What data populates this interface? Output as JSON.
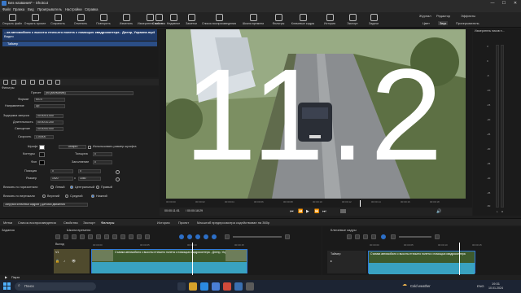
{
  "window": {
    "title": "Без названия* - Shotcut",
    "min": "—",
    "max": "☐",
    "close": "✕"
  },
  "menu": [
    "Файл",
    "Правка",
    "Вид",
    "Проигрыватель",
    "Настройки",
    "Справка"
  ],
  "toolbar": {
    "buttons": [
      "Открыть файл",
      "Открыть прочее",
      "Сохранить",
      "Отменить",
      "Повторить",
      "Изменить",
      "Выделить",
      "Измеритель пиков",
      "Свойства",
      "Недавние",
      "Заметки",
      "Список воспроизведения",
      "Шкала времени",
      "Фильтры",
      "Ключевые кадры",
      "История",
      "Экспорт",
      "Задачи"
    ],
    "layouts_top": [
      "Журнал",
      "Редактор",
      "Эффекты"
    ],
    "layouts_bottom": [
      "Цвет",
      "Звук",
      "Проигрыватель"
    ],
    "active_layout": "Звук"
  },
  "playlist": {
    "header": "...ка автомобиля с высоты птичьего полета с помощью квадрокоптера - Днепр, Украина.mp4",
    "subheader": "Видео",
    "item": "Таймер"
  },
  "filters": {
    "title": "Фильтры",
    "preset_label": "Пресет",
    "preset_value": "(по умолчанию)",
    "format_label": "Формат",
    "format_value": "SS.S",
    "direction_label": "Направление",
    "direction_value": "Up",
    "delay_label": "Задержка запуска",
    "delay_value": "00:00:01.000",
    "duration_label": "Длительность",
    "duration_value": "00:00:10.200",
    "offset_label": "Смещение",
    "offset_value": "00:00:00.000",
    "speed_label": "Скорость",
    "speed_value": "1.00000",
    "font_label": "Шрифт",
    "font_button": "Ustopro",
    "font_size_option": "Использовать размер шрифта",
    "outline_label": "Контуры",
    "thickness_label": "Толщина",
    "thickness_value": "0",
    "bg_label": "Фон",
    "padding_label": "Заполнение",
    "padding_value": "0",
    "position_label": "Позиция",
    "position_x": "0",
    "position_y": "0",
    "size_label": "Размер",
    "size_w": "1920",
    "size_h": "1080",
    "size_x": "x",
    "halign_label": "Вписать по горизонтали",
    "halign_options": [
      "Левый",
      "Центральный",
      "Правый"
    ],
    "valign_label": "Вписать по вертикали",
    "valign_options": [
      "Верхний",
      "Средний",
      "Нижний"
    ],
    "bottom_button": "Загрузки ключевых кадров | Датчики движения"
  },
  "preview": {
    "overlay_text": "11.2",
    "ruler_ticks": [
      "00:00:00",
      "00:00:02",
      "00:00:04",
      "00:00:06",
      "00:00:08",
      "00:00:10",
      "00:00:12",
      "00:00:14",
      "00:00:16",
      "00:00:18"
    ],
    "timecode_current": "00:00:11:01",
    "timecode_total": "/ 00:00:18:29"
  },
  "right_panel": {
    "title": "Измеритель пиков н...",
    "scale": [
      "3",
      "0",
      "-5",
      "-10",
      "-15",
      "-20",
      "-25",
      "-30",
      "-35",
      "-40",
      "-45",
      "-50"
    ],
    "channels": [
      "L",
      "R"
    ]
  },
  "tabs_left": [
    "Метки",
    "Список воспроизведения",
    "Свойства",
    "Экспорт",
    "Фильтры"
  ],
  "tabs_right": [
    "История",
    "Проект",
    "Масштаб предпросмотра содействован на 360р"
  ],
  "timeline": {
    "title": "Шкала времени",
    "panel_title": "Задания",
    "track_header": "Выход",
    "track_name": "V1",
    "clip_label": "Съемка автомобиля с высоты птичьего полета с помощью квадрокоптера - Днепр, Украина.mp4",
    "ruler": [
      "00:00:00",
      "00:00:05",
      "00:00:10",
      "00:00:15"
    ]
  },
  "keyframes": {
    "title": "Ключевые кадры",
    "filter_name": "Таймер",
    "clip_label": "Съемка автомобиля с высоты птичьего полета с помощью квадрокоптера",
    "ruler": [
      "00:00:00",
      "00:00:05",
      "00:00:10",
      "00:00:15"
    ]
  },
  "status": {
    "pause_label": "Пауза"
  },
  "taskbar": {
    "search_placeholder": "Поиск",
    "weather": "Cold weather",
    "time": "19:31",
    "date": "10.01.2024",
    "lang": "ENG"
  },
  "colors": {
    "accent": "#2f7ad9",
    "playlist_header": "#1f3a69",
    "waveform": "#2d8fae",
    "taskbar": "#1c2433"
  }
}
